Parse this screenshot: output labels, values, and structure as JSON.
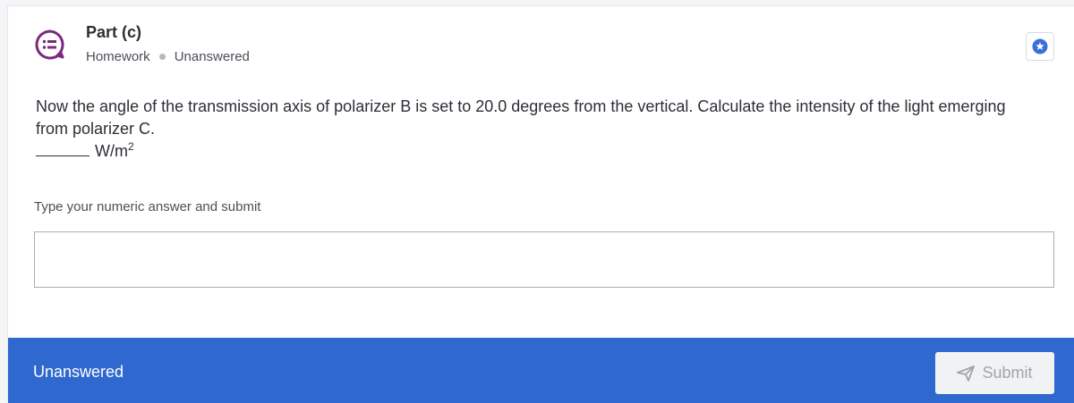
{
  "header": {
    "title": "Part (c)",
    "category": "Homework",
    "status": "Unanswered",
    "icon": "chat-list-icon",
    "bookmark_icon": "star-badge-icon"
  },
  "question": {
    "text": "Now the angle of the transmission axis of polarizer B is set to 20.0 degrees from the vertical. Calculate the intensity of the light emerging from polarizer C.",
    "unit_base": "W/m",
    "unit_exponent": "2"
  },
  "answer": {
    "prompt": "Type your numeric answer and submit",
    "value": "",
    "placeholder": ""
  },
  "footer": {
    "status": "Unanswered",
    "submit_label": "Submit",
    "submit_icon": "send-icon"
  },
  "colors": {
    "accent": "#2f69cf",
    "icon_purple": "#7b2a7f",
    "star_blue": "#3a6fd8"
  }
}
